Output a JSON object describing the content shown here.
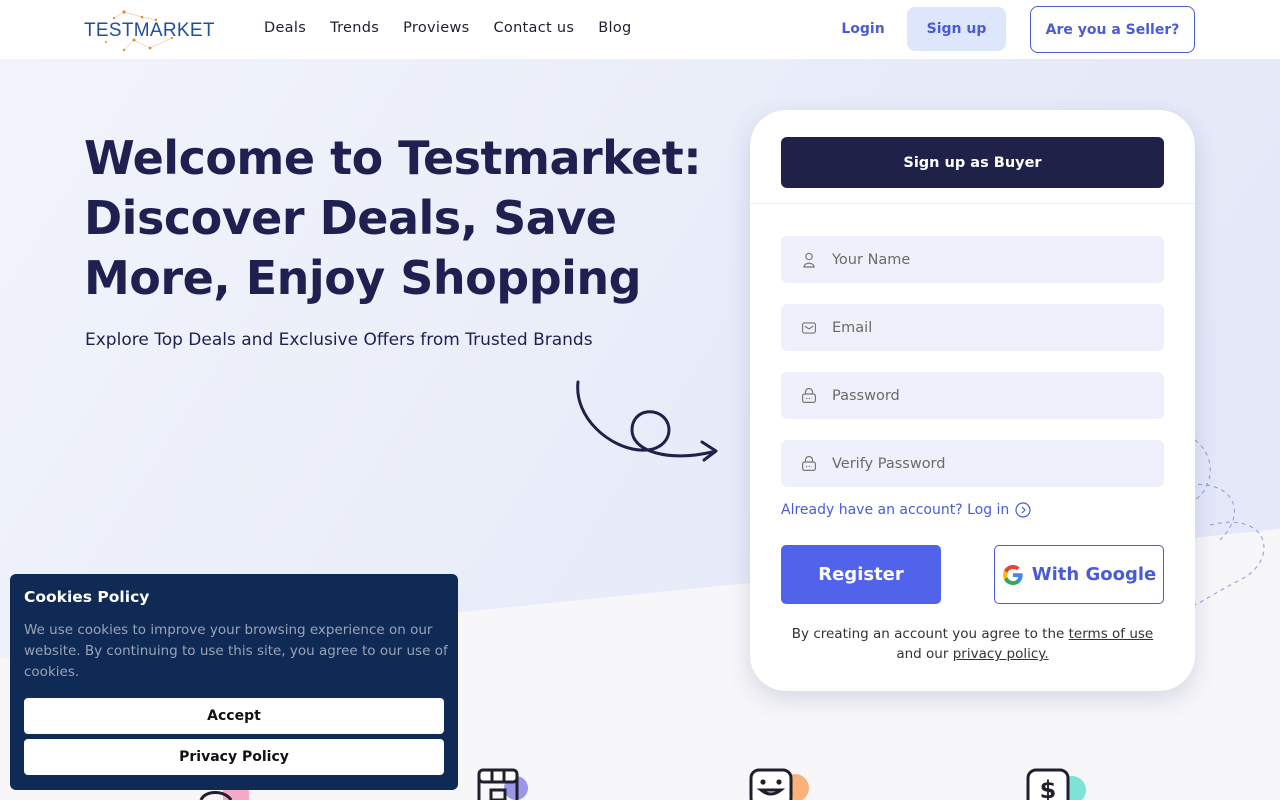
{
  "header": {
    "logo_text": "TESTMARKET",
    "nav": [
      "Deals",
      "Trends",
      "Proviews",
      "Contact us",
      "Blog"
    ],
    "login": "Login",
    "signup": "Sign up",
    "seller": "Are you a Seller?"
  },
  "hero": {
    "title": "Welcome to Testmarket: Discover Deals, Save More, Enjoy Shopping",
    "subtitle": "Explore Top Deals and Exclusive Offers from Trusted Brands"
  },
  "signup_card": {
    "header_button": "Sign up as Buyer",
    "fields": {
      "name_placeholder": "Your Name",
      "email_placeholder": "Email",
      "password_placeholder": "Password",
      "verify_placeholder": "Verify Password"
    },
    "login_link": "Already have an account? Log in",
    "register": "Register",
    "google": "With Google",
    "terms_prefix": "By creating an account you agree to the",
    "terms_link": "terms of use",
    "terms_middle": "and our",
    "privacy_link": "privacy policy."
  },
  "cookies": {
    "title": "Cookies Policy",
    "text": "We use cookies to improve your browsing experience on our website. By continuing to use this site, you agree to our use of cookies.",
    "accept": "Accept",
    "privacy": "Privacy Policy"
  },
  "colors": {
    "brand_dark": "#1f2149",
    "accent": "#5163ea",
    "cookie_bg": "#0f2a55"
  },
  "icons": [
    "user-icon",
    "mail-icon",
    "lock-icon",
    "arrow-circle-icon",
    "google-icon",
    "store-icon",
    "smile-icon",
    "dollar-icon"
  ]
}
